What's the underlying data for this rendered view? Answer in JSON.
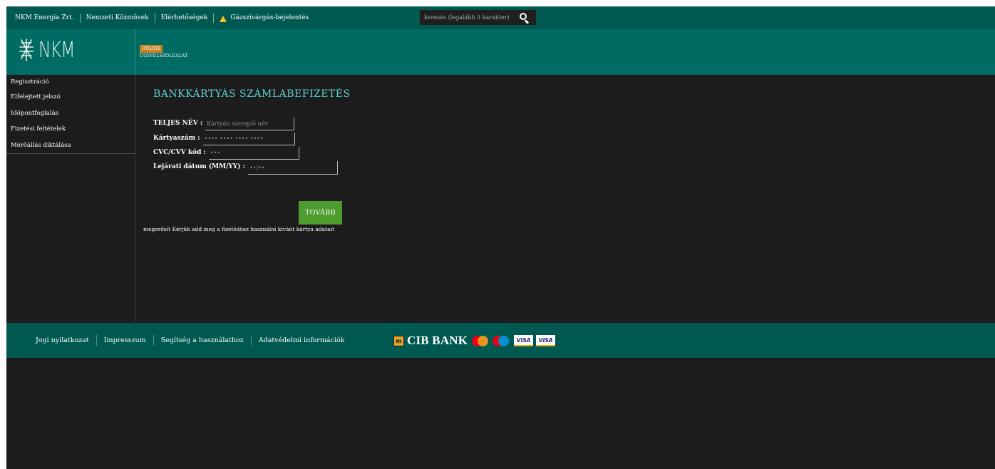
{
  "topbar": {
    "links": [
      "NKM Energia Zrt.",
      "Nemzeti Közművek",
      "Elérhetőségek",
      "Gázszivárgás-bejelentés"
    ],
    "search_placeholder": "keresés (legalább 3 karakter)",
    "search_icon": "magnifier-icon",
    "warning_icon": "warning-triangle-icon"
  },
  "header": {
    "logo_text": "NKM",
    "badge": "ONLINE",
    "service": "ÜGYFÉLSZOLGÁLAT"
  },
  "sidebar": {
    "items": [
      "Regisztráció",
      "Elfelejtett jelszó",
      "Időpontfoglalás",
      "Fizetési feltételek",
      "Mérőállás diktálása"
    ]
  },
  "form": {
    "title": "BANKKÁRTYÁS SZÁMLABEFIZETÉS",
    "name_label": "TELJES NÉV :",
    "name_placeholder": "Kártyán szereplő név",
    "card_label": "Kártyaszám :",
    "card_placeholder": "•••• •••• •••• ••••",
    "cvc_label": "CVC/CVV kód :",
    "cvc_placeholder": "•••",
    "expiry_label": "Lejárati dátum (MM/YY) :",
    "expiry_placeholder": "••/••",
    "submit_label": "TOVÁBB",
    "hint": "megerősít Kérjük add meg a fizetéshez használni kívánt kártya adatait"
  },
  "footer": {
    "links": [
      "Jogi nyilatkozat",
      "Impresszum",
      "Segítség a használathoz",
      "Adatvédelmi információk"
    ],
    "bank_name": "CIB BANK",
    "bank_icon_text": "m",
    "card_brands": [
      "VISA",
      "VISA"
    ]
  },
  "colors": {
    "topbar": "#005951",
    "header": "#006b63",
    "title": "#5fd3d3",
    "button": "#4d9c2d",
    "badge": "#c9801f"
  }
}
